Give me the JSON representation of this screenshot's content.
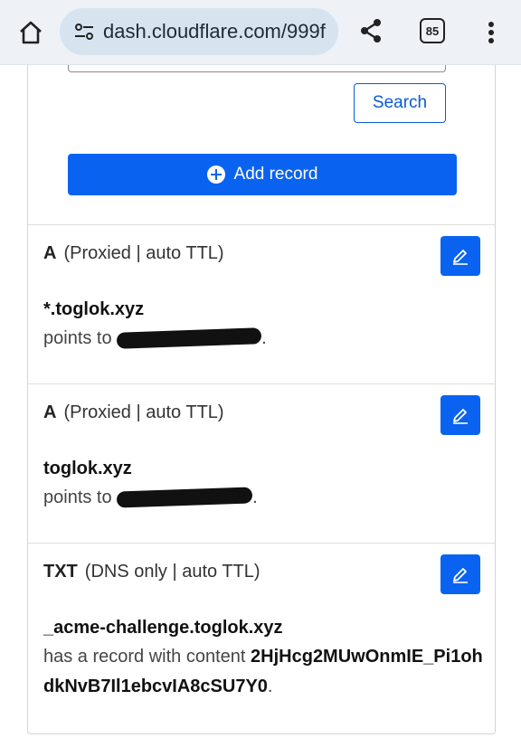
{
  "browser": {
    "url": "dash.cloudflare.com/999f",
    "tab_count": "85"
  },
  "toolbar": {
    "search_label": "Search",
    "add_record_label": "Add record"
  },
  "records": [
    {
      "type": "A",
      "meta": "(Proxied | auto TTL)",
      "name": "*.toglok.xyz",
      "prefix": "points to",
      "value_redacted": true,
      "suffix": "."
    },
    {
      "type": "A",
      "meta": "(Proxied | auto TTL)",
      "name": "toglok.xyz",
      "prefix": "points to",
      "value_redacted": true,
      "suffix": "."
    },
    {
      "type": "TXT",
      "meta": "(DNS only | auto TTL)",
      "name": "_acme-challenge.toglok.xyz",
      "prefix": "has a record with content",
      "content": "2HjHcg2MUwOnmIE_Pi1ohdkNvB7Il1ebcvIA8cSU7Y0",
      "suffix": "."
    }
  ],
  "colors": {
    "primary": "#0a63f0",
    "outline": "#0a5bd3",
    "chrome_bg": "#eef2f7"
  }
}
